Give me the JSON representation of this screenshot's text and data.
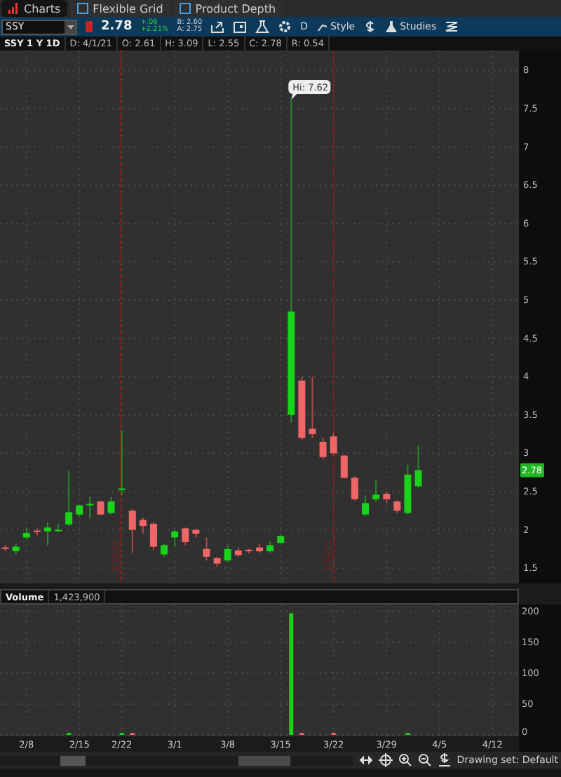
{
  "tabs": [
    {
      "label": "Charts",
      "selected": true
    },
    {
      "label": "Flexible Grid",
      "selected": false
    },
    {
      "label": "Product Depth",
      "selected": false
    }
  ],
  "toolbar": {
    "symbol": "SSY",
    "last": "2.78",
    "change": "+.06",
    "change_pct": "+2.21%",
    "bid": "B: 2.60",
    "ask": "A: 2.75",
    "aggregation": "D",
    "style": "Style",
    "studies": "Studies"
  },
  "info_bar": [
    "SSY 1 Y 1D",
    "D: 4/1/21",
    "O: 2.61",
    "H: 3.09",
    "L: 2.55",
    "C: 2.78",
    "R: 0.54"
  ],
  "price_chart": {
    "chart_data": {
      "type": "candlestick",
      "grid": true,
      "ylim": [
        1.3,
        8.26
      ],
      "yticks": [
        1.5,
        2,
        2.5,
        3,
        3.5,
        4,
        4.5,
        5,
        5.5,
        6,
        6.5,
        7,
        7.5,
        8
      ],
      "ohlc": [
        [
          1.77,
          1.8,
          1.72,
          1.75
        ],
        [
          1.72,
          1.82,
          1.68,
          1.78
        ],
        [
          1.9,
          2.03,
          1.88,
          1.96
        ],
        [
          1.99,
          2.02,
          1.93,
          1.97
        ],
        [
          1.98,
          2.1,
          1.8,
          2.03
        ],
        [
          2.0,
          2.08,
          1.97,
          2.0
        ],
        [
          2.07,
          2.77,
          2.05,
          2.23
        ],
        [
          2.2,
          2.33,
          2.18,
          2.32
        ],
        [
          2.32,
          2.43,
          2.15,
          2.34
        ],
        [
          2.37,
          2.38,
          2.2,
          2.2
        ],
        [
          2.22,
          2.43,
          2.2,
          2.37
        ],
        [
          2.52,
          3.3,
          2.45,
          2.54
        ],
        [
          2.25,
          2.27,
          1.7,
          2.0
        ],
        [
          2.13,
          2.16,
          1.95,
          2.05
        ],
        [
          2.08,
          2.1,
          1.73,
          1.78
        ],
        [
          1.68,
          1.82,
          1.65,
          1.8
        ],
        [
          1.9,
          2.0,
          1.78,
          1.98
        ],
        [
          2.02,
          2.03,
          1.8,
          1.84
        ],
        [
          2.0,
          2.01,
          1.9,
          1.95
        ],
        [
          1.75,
          1.9,
          1.6,
          1.65
        ],
        [
          1.63,
          1.65,
          1.52,
          1.56
        ],
        [
          1.6,
          1.79,
          1.58,
          1.75
        ],
        [
          1.73,
          1.77,
          1.65,
          1.67
        ],
        [
          1.74,
          1.75,
          1.69,
          1.72
        ],
        [
          1.77,
          1.82,
          1.7,
          1.72
        ],
        [
          1.72,
          1.85,
          1.7,
          1.8
        ],
        [
          1.83,
          1.93,
          1.82,
          1.92
        ],
        [
          3.5,
          7.62,
          3.4,
          4.85
        ],
        [
          3.95,
          4.0,
          3.17,
          3.2
        ],
        [
          3.32,
          4.0,
          3.2,
          3.25
        ],
        [
          3.15,
          3.2,
          2.92,
          2.95
        ],
        [
          3.22,
          3.27,
          2.98,
          3.0
        ],
        [
          2.97,
          2.98,
          2.67,
          2.68
        ],
        [
          2.68,
          2.7,
          2.38,
          2.4
        ],
        [
          2.2,
          2.45,
          2.18,
          2.35
        ],
        [
          2.4,
          2.65,
          2.37,
          2.46
        ],
        [
          2.47,
          2.5,
          2.35,
          2.4
        ],
        [
          2.37,
          2.39,
          2.22,
          2.25
        ],
        [
          2.22,
          2.85,
          2.2,
          2.72
        ],
        [
          2.57,
          3.1,
          2.55,
          2.78
        ],
        null,
        null,
        null,
        null,
        null,
        null,
        null,
        null,
        null
      ],
      "categories": [
        null,
        null,
        null,
        null,
        null,
        null,
        null,
        null,
        null,
        null,
        null,
        null,
        null,
        null,
        null,
        null,
        null,
        null,
        null,
        null,
        null,
        null,
        null,
        null,
        null,
        null,
        null,
        null,
        null,
        null,
        null,
        null,
        null,
        null,
        null,
        null,
        null,
        null,
        null,
        null,
        null,
        null,
        null,
        null,
        null,
        null,
        null,
        null,
        null
      ]
    },
    "high_label": "Hi: 7.62",
    "last_price_tag": "2.78",
    "event_lines": [
      {
        "label": "2/19/21"
      },
      {
        "label": "3/19/21"
      }
    ]
  },
  "volume_header": {
    "label": "Volume",
    "value": "1,423,900"
  },
  "volume_chart": {
    "chart_data": {
      "type": "bar",
      "grid": true,
      "ylim": [
        0,
        211
      ],
      "yticks": [
        0,
        50,
        100,
        150,
        200
      ],
      "categories": [
        null,
        null,
        "2/8",
        null,
        null,
        null,
        null,
        "2/15",
        null,
        null,
        null,
        "2/22",
        null,
        null,
        null,
        null,
        "3/1",
        null,
        null,
        null,
        null,
        "3/8",
        null,
        null,
        null,
        null,
        "3/15",
        null,
        null,
        null,
        null,
        "3/22",
        null,
        null,
        null,
        null,
        "3/29",
        null,
        null,
        null,
        null,
        "4/5",
        null,
        null,
        null,
        null,
        "4/12",
        null,
        null
      ],
      "series": [
        {
          "color": "#19d219",
          "values": [
            null,
            null,
            null,
            null,
            null,
            null,
            2,
            null,
            null,
            null,
            null,
            3,
            null,
            null,
            null,
            null,
            null,
            null,
            null,
            null,
            null,
            null,
            null,
            null,
            null,
            null,
            null,
            197,
            null,
            null,
            null,
            null,
            null,
            null,
            null,
            null,
            null,
            null,
            1,
            null,
            null,
            null,
            null,
            null,
            null,
            null,
            null,
            null,
            null
          ]
        },
        {
          "color": "#f06666",
          "values": [
            null,
            null,
            null,
            null,
            null,
            null,
            null,
            null,
            null,
            null,
            null,
            null,
            1,
            null,
            null,
            null,
            null,
            null,
            null,
            null,
            null,
            null,
            null,
            null,
            null,
            null,
            null,
            null,
            3,
            null,
            null,
            2,
            null,
            null,
            null,
            null,
            null,
            null,
            null,
            null,
            null,
            null,
            null,
            null,
            null,
            null,
            null,
            null,
            null
          ]
        }
      ]
    }
  },
  "footer": {
    "drawing_set": "Drawing set: Default"
  }
}
